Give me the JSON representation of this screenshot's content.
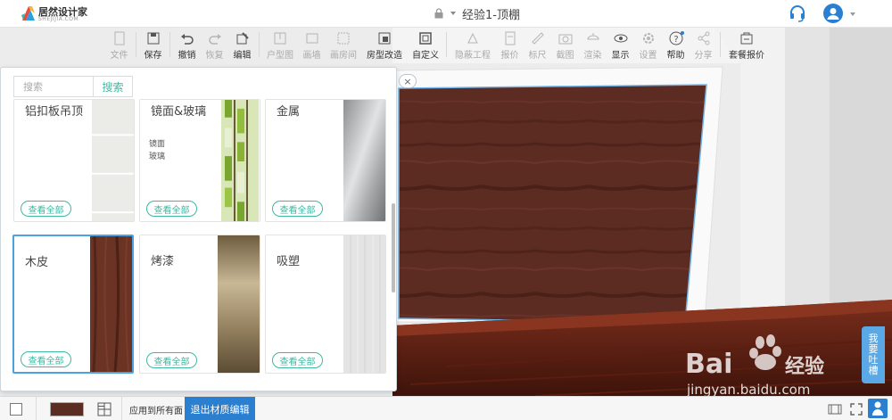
{
  "app": {
    "logo_text": "居然设计家",
    "logo_sub": "SHEJIJIA.COM",
    "title": "经验1-顶棚",
    "brand_color": "#3eb8a2",
    "accent_color": "#2b7fd1"
  },
  "toolbar": {
    "items": [
      {
        "label": "文件",
        "icon": "file-icon",
        "enabled": false
      },
      {
        "label": "保存",
        "icon": "save-icon",
        "enabled": true
      },
      {
        "label": "撤销",
        "icon": "undo-icon",
        "enabled": true
      },
      {
        "label": "恢复",
        "icon": "redo-icon",
        "enabled": false
      },
      {
        "label": "编辑",
        "icon": "edit-icon",
        "enabled": true
      },
      {
        "label": "户型图",
        "icon": "floorplan-icon",
        "enabled": false
      },
      {
        "label": "画墙",
        "icon": "draw-wall-icon",
        "enabled": false
      },
      {
        "label": "画房间",
        "icon": "draw-room-icon",
        "enabled": false
      },
      {
        "label": "房型改造",
        "icon": "room-remodel-icon",
        "enabled": true
      },
      {
        "label": "自定义",
        "icon": "customize-icon",
        "enabled": true
      },
      {
        "label": "隐蔽工程",
        "icon": "hidden-work-icon",
        "enabled": false
      },
      {
        "label": "报价",
        "icon": "quote-icon",
        "enabled": false
      },
      {
        "label": "标尺",
        "icon": "ruler-icon",
        "enabled": false
      },
      {
        "label": "截图",
        "icon": "camera-icon",
        "enabled": false
      },
      {
        "label": "渲染",
        "icon": "render-icon",
        "enabled": false
      },
      {
        "label": "显示",
        "icon": "display-icon",
        "enabled": true
      },
      {
        "label": "设置",
        "icon": "settings-icon",
        "enabled": false
      },
      {
        "label": "帮助",
        "icon": "help-icon",
        "enabled": true
      },
      {
        "label": "分享",
        "icon": "share-icon",
        "enabled": false
      },
      {
        "label": "套餐报价",
        "icon": "package-quote-icon",
        "enabled": true
      }
    ]
  },
  "material_panel": {
    "search_placeholder": "搜索",
    "search_button": "搜索",
    "view_all_label": "查看全部",
    "close_glyph": "×",
    "cards": [
      {
        "name": "铝扣板吊顶",
        "swatch": "aluminum-ceiling",
        "selected": false
      },
      {
        "name": "镜面&玻璃",
        "sub": [
          "镜面",
          "玻璃"
        ],
        "swatch": "mirror-glass",
        "selected": false
      },
      {
        "name": "金属",
        "swatch": "metal",
        "selected": false
      },
      {
        "name": "木皮",
        "swatch": "wood-veneer",
        "selected": true
      },
      {
        "name": "烤漆",
        "swatch": "lacquer",
        "selected": false
      },
      {
        "name": "吸塑",
        "swatch": "blister",
        "selected": false
      }
    ]
  },
  "feedback_tab": {
    "chars": [
      "我",
      "要",
      "吐",
      "槽"
    ]
  },
  "watermark": {
    "brand": "Bai du 经验",
    "url": "jingyan.baidu.com"
  },
  "bottom_bar": {
    "apply_all": "应用到所有面",
    "exit_material_edit": "退出材质编辑",
    "current_color": "#5a2c22"
  }
}
